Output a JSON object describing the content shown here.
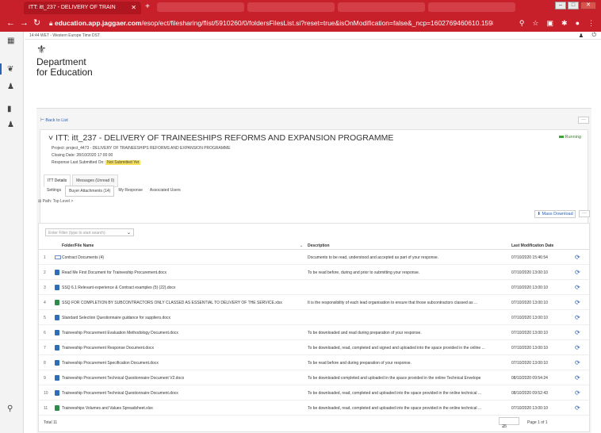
{
  "browser": {
    "active_tab": "ITT: itt_237 - DELIVERY OF TRAIN",
    "url_domain": "education.app.jaggaer.com",
    "url_path": "/esop/ect/filesharing/flist/5910260/0/foldersFilesList.si?reset=true&isOnModification=false&_ncp=1602769460610.159895-2"
  },
  "infobar": {
    "timezone": "14:44 WET - Western Europe Time DST"
  },
  "logo": {
    "line1": "Department",
    "line2": "for Education"
  },
  "page": {
    "back_label": "Back to List",
    "title": "ITT: itt_237 - DELIVERY OF TRAINEESHIPS REFORMS AND EXPANSION PROGRAMME",
    "project": "Project: project_4473 - DELIVERY OF TRAINEESHIPS REFORMS AND EXPANSION PROGRAMME",
    "closing_date": "Closing Date: 28/10/2020 17:00:00",
    "response_label": "Response Last Submitted On:",
    "response_value": "Not Submitted Yet",
    "status": "Running",
    "tabs_primary": [
      "ITT Details",
      "Messages (Unread 0)"
    ],
    "tabs_secondary": [
      "Settings",
      "Buyer Attachments (14)",
      "My Response",
      "Associated Users"
    ],
    "path": "Path: Top Level >",
    "mass_download": "Mass Download"
  },
  "table": {
    "filter_placeholder": "Enter Filter (type to start search)",
    "headers": {
      "name": "Folder/File Name",
      "description": "Description",
      "date": "Last Modification Date"
    },
    "rows": [
      {
        "n": "1",
        "name": "Contract Documents (4)",
        "desc": "Documents to be read, understood and accepted as part of your response.",
        "date": "07/10/2020 15:46:54",
        "folder": true
      },
      {
        "n": "2",
        "name": "Read Me First Document for Traineeship Procurement.docx",
        "desc": "To be read before, during and prior to submitting your response.",
        "date": "07/10/2020 13:00:10"
      },
      {
        "n": "3",
        "name": "SSQ 6.1 Relevant experience & Contract examples (5) (22).docx",
        "desc": "",
        "date": "07/10/2020 13:00:10"
      },
      {
        "n": "4",
        "name": "SSQ FOR COMPLETION BY SUBCONTRACTORS ONLY CLASSED AS ESSENTIAL TO DELIVERY OF THE SERVICE.xlsx",
        "desc": "It is the responsibility of each lead organisation to ensure that those subcontractors classed as ...",
        "date": "07/10/2020 13:00:10"
      },
      {
        "n": "5",
        "name": "Standard Selection Questionnaire guidance for suppliers.docx",
        "desc": "",
        "date": "07/10/2020 13:00:10"
      },
      {
        "n": "6",
        "name": "Traineeship Procurement Evaluation Methodology Document.docx",
        "desc": "To be downloaded and read during preparation of your response.",
        "date": "07/10/2020 13:00:10"
      },
      {
        "n": "7",
        "name": "Traineeship Procurement Response Document.docx",
        "desc": "To be downloaded, read, completed and signed and uploaded into the space provided in the online ...",
        "date": "07/10/2020 13:00:10"
      },
      {
        "n": "8",
        "name": "Traineeship Procurement Specification Document.docx",
        "desc": "To be read before and during preparation of your response.",
        "date": "07/10/2020 13:00:10"
      },
      {
        "n": "9",
        "name": "Traineeship Procurement Technical Questionnaire Document V2.docx",
        "desc": "To be downloaded completed and uploaded in the space provided in the online Technical Envelope",
        "date": "08/10/2020 09:54:24"
      },
      {
        "n": "10",
        "name": "Traineeship Procurement Technical Questionnaire Document.docx",
        "desc": "To be downloaded, read, completed and uploaded into the space provided in the online technical ...",
        "date": "08/10/2020 09:52:43"
      },
      {
        "n": "11",
        "name": "Traineeships Volumes and Values Spreadsheet.xlsx",
        "desc": "To be downloaded, read, completed and uploaded into the space provided in the online technical ...",
        "date": "07/10/2020 13:00:10"
      }
    ],
    "total": "Total 11",
    "page_size": "25",
    "page_info": "Page 1 of 1"
  }
}
